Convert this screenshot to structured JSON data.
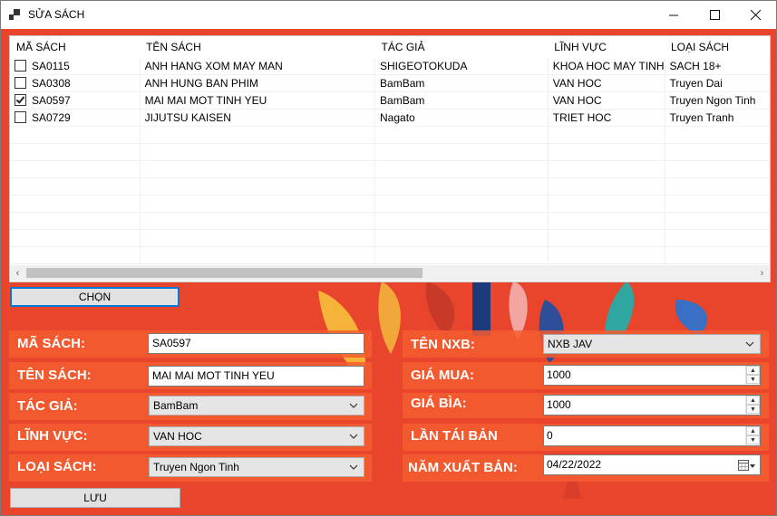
{
  "window": {
    "title": "SỬA SÁCH",
    "icons": [
      "app-icon",
      "minimize-icon",
      "maximize-icon",
      "close-icon"
    ]
  },
  "grid": {
    "columns": [
      "MÃ SÁCH",
      "TÊN SÁCH",
      "TÁC GIẢ",
      "LĨNH VỰC",
      "LOẠI SÁCH"
    ],
    "rows": [
      {
        "checked": false,
        "cells": [
          "SA0115",
          "ANH HANG XOM MAY MAN",
          "SHIGEOTOKUDA",
          "KHOA HOC MAY TINH",
          "SACH 18+"
        ]
      },
      {
        "checked": false,
        "cells": [
          "SA0308",
          "ANH HUNG BAN PHIM",
          "BamBam",
          "VAN HOC",
          "Truyen Dai"
        ]
      },
      {
        "checked": true,
        "cells": [
          "SA0597",
          "MAI MAI MOT TINH YEU",
          "BamBam",
          "VAN HOC",
          "Truyen Ngon Tinh"
        ]
      },
      {
        "checked": false,
        "cells": [
          "SA0729",
          "JIJUTSU KAISEN",
          "Nagato",
          "TRIET HOC",
          "Truyen Tranh"
        ]
      }
    ],
    "scroll_left_icon": "‹",
    "scroll_right_icon": "›"
  },
  "buttons": {
    "select": "CHỌN",
    "save": "LƯU"
  },
  "form": {
    "ma_sach": {
      "label": "MÃ SÁCH:",
      "value": "SA0597"
    },
    "ten_sach": {
      "label": "TÊN SÁCH:",
      "value": "MAI MAI MOT TINH YEU"
    },
    "tac_gia": {
      "label": "TÁC GIẢ:",
      "value": "BamBam"
    },
    "linh_vuc": {
      "label": "LĨNH VỰC:",
      "value": "VAN HOC"
    },
    "loai_sach": {
      "label": "LOẠI SÁCH:",
      "value": "Truyen Ngon Tinh"
    },
    "ten_nxb": {
      "label": "TÊN NXB:",
      "value": "NXB JAV"
    },
    "gia_mua": {
      "label": "GIÁ MUA:",
      "value": "1000"
    },
    "gia_bia": {
      "label": "GIÁ BÌA:",
      "value": "1000"
    },
    "lan_tai_ban": {
      "label": "LẦN TÁI BẢN",
      "value": "0"
    },
    "nam_xuat_ban": {
      "label": "NĂM XUẤT BẢN:",
      "value": "04/22/2022"
    }
  },
  "colors": {
    "background": "#e8452c",
    "panel": "#f45d30",
    "focus": "#0078d7"
  }
}
